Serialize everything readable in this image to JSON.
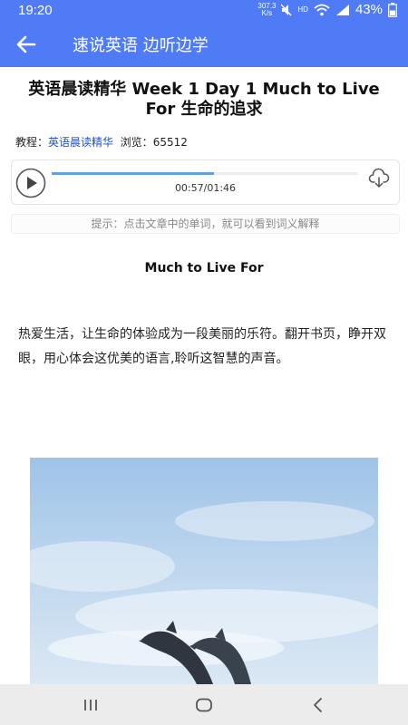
{
  "status_bar": {
    "time": "19:20",
    "net_speed_value": "307.3",
    "net_speed_unit": "K/s",
    "hd_label": "HD",
    "battery": "43%"
  },
  "app_bar": {
    "title": "速说英语 边听边学"
  },
  "article": {
    "title": "英语晨读精华 Week 1 Day 1 Much to Live For 生命的追求",
    "meta_course_label": "教程：",
    "meta_course_value": "英语晨读精华",
    "meta_views_label": "浏览：",
    "meta_views_value": "65512",
    "subtitle": "Much to Live For",
    "intro": "热爱生活，让生命的体验成为一段美丽的乐符。翻开书页，睁开双眼，用心体会这优美的语言,聆听这智慧的声音。"
  },
  "player": {
    "time_display": "00:57/01:46",
    "progress_fraction": 0.53
  },
  "hint": {
    "text": "提示：点击文章中的单词，就可以看到词义解释"
  },
  "colors": {
    "accent": "#4F7BF7",
    "progress": "#64A0DC",
    "link": "#1e50c8"
  },
  "icons": {
    "back": "arrow-left",
    "play": "play-circle",
    "download": "cloud-download",
    "nav_recent": "recent-apps",
    "nav_home": "home",
    "nav_back": "chevron-left"
  }
}
